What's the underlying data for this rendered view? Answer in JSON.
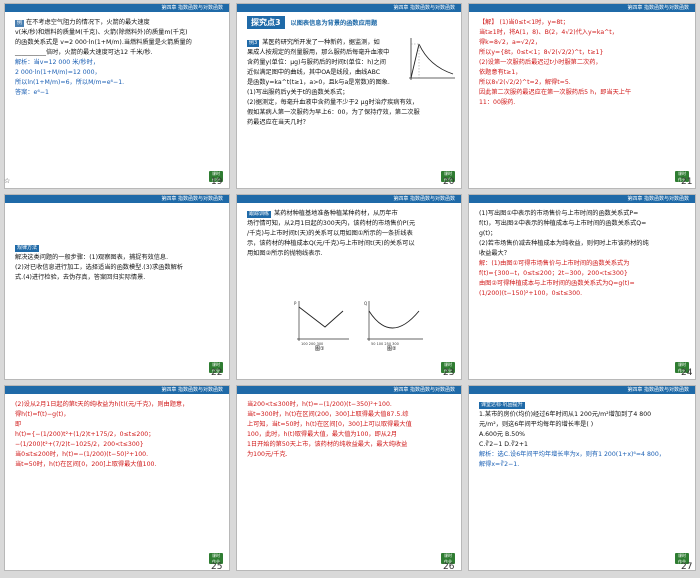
{
  "header_title": "第四章  指数函数与对数函数",
  "nav_button_line1": "课时",
  "nav_button_line2": "作业",
  "slides": [
    {
      "page": "19",
      "lines": [
        "在不考虑空气阻力的情况下，火箭的最大速度",
        "v(米/秒)和燃料的质量M(千克)、火箭(除燃料外)的质量m(千克)",
        "的函数关系式是  v=2 000·ln(1+M/m).当燃料质量是火箭质量的",
        "__________倍时，火箭的最大速度可达12 千米/秒.",
        "解析：当v=12 000 米/秒时，",
        "2 000·ln(1+M/m)=12 000，",
        "所以ln(1+M/m)=6，所以M/m=e⁶−1.",
        "答案：e⁶−1"
      ]
    },
    {
      "page": "20",
      "section_num": "探究点3",
      "section_title": "以图表信息为背景的函数应用题",
      "example_tag": "例3",
      "lines": [
        "某医药研究所开发了一种新药，据监测，如",
        "果成人按规定的剂量服用，那么服药后每毫升血液中",
        "含药量y(单位：μg)与服药后的时间t(单位：h)之间",
        "近似满足图中的曲线，其中OA是线段，曲线ABC",
        "是函数y=ka^t(t≥1，a>0，且k与a是常数)的图象.",
        "(1)写出服药后y关于t的函数关系式；",
        "(2)据测定，每毫升血液中含药量不少于2 μg时治疗疾病有效，",
        "假如某病人第一次服药为早上6：00，为了保持疗效，第二次服",
        "药最迟应在当天几时？"
      ]
    },
    {
      "page": "21",
      "lines": [
        "【解】 (1)当0≤t<1时，y=8t；",
        "当t≥1时，将A(1，8)、B(2，4√2)代入y=ka^t，",
        "得k=8√2，a=√2/2，",
        "所以y={8t，0≤t<1；8√2(√2/2)^t，t≥1}",
        "(2)设第一次服药后最迟过t小时服第二次药，",
        "依题意有t≥1，",
        "所以8√2(√2/2)^t=2，解得t=5.",
        "因此第二次服药最迟应在第一次服药后5 h，即当天上午",
        "11：00服药."
      ]
    },
    {
      "page": "22",
      "tag": "规律方法",
      "lines": [
        "解决这类问题的一般步骤：(1)观察图表，捕捉有效信息.",
        "(2)对已收信息进行加工，选择适当的函数模型.(3)求函数解析",
        "式.(4)进行检验，去伪存真，答案回归实际情景."
      ]
    },
    {
      "page": "23",
      "tag": "跟踪训练",
      "lines": [
        "某药材种植基地准备种植某种药材，从历年市",
        "场行情可知，从2月1日起的300天内，该药材的市场售价P(元",
        "/千克)与上市时间t(天)的关系可以用如图①所示的一条折线表",
        "示，该药材的种植成本Q(元/千克)与上市时间t(天)的关系可以",
        "用如图②所示的抛物线表示."
      ],
      "fig1_caption": "图①",
      "fig2_caption": "图②"
    },
    {
      "page": "24",
      "lines": [
        "(1)写出图①中表示的市场售价与上市时间的函数关系式P=",
        "f(t)，写出图②中表示的种植成本与上市时间的函数关系式Q=",
        "g(t)；",
        "(2)若市场售价减去种植成本为纯收益，则何时上市该药材的纯",
        "收益最大？",
        "解：(1)由图①可得市场售价与上市时间的函数关系式为",
        "f(t)={300−t，0≤t≤200；2t−300，200<t≤300}",
        "由图②可得种植成本与上市时间的函数关系式为Q=g(t)=",
        "(1/200)(t−150)²+100，0≤t≤300."
      ]
    },
    {
      "page": "25",
      "lines": [
        "(2)设从2月1日起的第t天的纯收益为h(t)(元/千克)，则由题意，",
        "得h(t)=f(t)−g(t)，",
        "即",
        "h(t)={−(1/200)t²+(1/2)t+175/2，0≤t≤200；",
        "−(1/200)t²+(7/2)t−1025/2，200<t≤300}",
        "当0≤t≤200时，h(t)=−(1/200)(t−50)²+100.",
        "当t=50时，h(t)在区间[0，200]上取得最大值100."
      ]
    },
    {
      "page": "26",
      "lines": [
        "当200<t≤300时，h(t)=−(1/200)(t−350)²+100.",
        "当t=300时，h(t)在区间(200，300]上取得最大值87.5.综",
        "上可知，当t=50时，h(t)在区间[0，300]上可以取得最大值",
        "100，此时，h(t)取得最大值，最大值为100，即从2月",
        "1日开始的第50天上市，该药材的纯收益最大，最大纯收益",
        "为100元/千克."
      ]
    },
    {
      "page": "27",
      "tag": "课堂达标·巩固提升",
      "lines": [
        "1.某市的房价(均价)经过6年时间从1 200元/m²增加到了4 800",
        "元/m²，则这6年间平均每年的增长率是(   )",
        "A.600元          B.50%",
        "C.∛2−1          D.∛2+1",
        "解析：选C.设6年间平均年增长率为x，则有1 200(1+x)⁶=4 800，",
        "解得x=∛2−1."
      ]
    }
  ]
}
